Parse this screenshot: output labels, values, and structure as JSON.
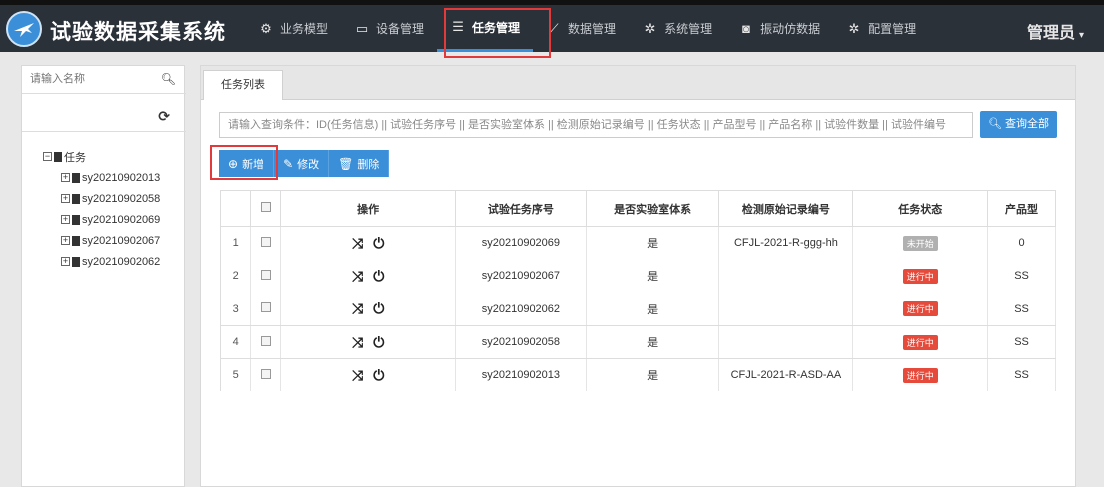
{
  "app": {
    "title": "试验数据采集系统",
    "user": "管理员"
  },
  "nav": {
    "items": [
      {
        "label": "业务模型",
        "icon": "cubes-icon",
        "glyph": "⚙"
      },
      {
        "label": "设备管理",
        "icon": "inbox-icon",
        "glyph": "▭"
      },
      {
        "label": "任务管理",
        "icon": "tasks-icon",
        "glyph": "☰"
      },
      {
        "label": "数据管理",
        "icon": "line-chart-icon",
        "glyph": "⟋"
      },
      {
        "label": "系统管理",
        "icon": "gear-icon",
        "glyph": "✲"
      },
      {
        "label": "振动仿数据",
        "icon": "camera-icon",
        "glyph": "◙"
      },
      {
        "label": "配置管理",
        "icon": "gears-icon",
        "glyph": "✲"
      }
    ],
    "active_index": 2
  },
  "left": {
    "search_placeholder": "请输入名称",
    "tree": {
      "root": "任务",
      "children": [
        "sy20210902013",
        "sy20210902058",
        "sy20210902069",
        "sy20210902067",
        "sy20210902062"
      ]
    }
  },
  "main": {
    "tab": "任务列表",
    "query_placeholder": "请输入查询条件：ID(任务信息) || 试验任务序号 || 是否实验室体系 || 检测原始记录编号 || 任务状态 || 产品型号 || 产品名称 || 试验件数量 || 试验件编号",
    "query_button": "查询全部",
    "buttons": {
      "add": "新增",
      "edit": "修改",
      "delete": "删除"
    },
    "table": {
      "headers": [
        "",
        "",
        "操作",
        "试验任务序号",
        "是否实验室体系",
        "检测原始记录编号",
        "任务状态",
        "产品型"
      ],
      "rows": [
        {
          "num": "1",
          "task_no": "sy20210902069",
          "lab": "是",
          "record": "CFJL-2021-R-ggg-hh",
          "status": "未开始",
          "status_color": "gray",
          "product": "0"
        },
        {
          "num": "2",
          "task_no": "sy20210902067",
          "lab": "是",
          "record": "",
          "status": "进行中",
          "status_color": "red",
          "product": "SS"
        },
        {
          "num": "3",
          "task_no": "sy20210902062",
          "lab": "是",
          "record": "",
          "status": "进行中",
          "status_color": "red",
          "product": "SS"
        },
        {
          "num": "4",
          "task_no": "sy20210902058",
          "lab": "是",
          "record": "",
          "status": "进行中",
          "status_color": "red",
          "product": "SS"
        },
        {
          "num": "5",
          "task_no": "sy20210902013",
          "lab": "是",
          "record": "CFJL-2021-R-ASD-AA",
          "status": "进行中",
          "status_color": "red",
          "product": "SS"
        }
      ]
    }
  },
  "colors": {
    "accent": "#3a8fd8",
    "topbar": "#2b3139",
    "status_red": "#e64a3b",
    "status_gray": "#b0b0b0",
    "highlight": "#e23a3a"
  }
}
